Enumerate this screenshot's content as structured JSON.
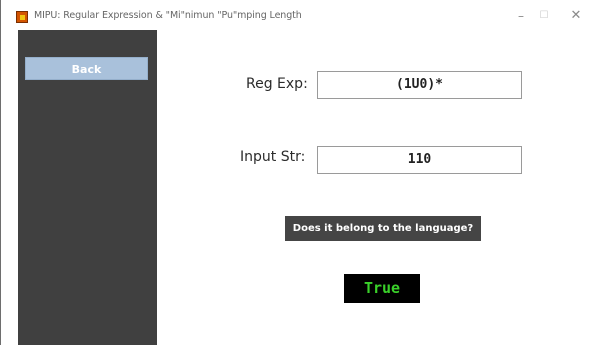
{
  "window": {
    "title": "MIPU: Regular Expression & \"Mi\"nimun \"Pu\"mping Length",
    "controls": {
      "minimize": "–",
      "maximize": "☐",
      "close": "✕"
    }
  },
  "sidebar": {
    "back_label": "Back"
  },
  "form": {
    "regexp_label": "Reg Exp:",
    "regexp_value": "(1U0)*",
    "input_label": "Input Str:",
    "input_value": "110"
  },
  "check_button_label": "Does it belong to the language?",
  "result": {
    "text": "True",
    "color": "#3ad12a"
  },
  "colors": {
    "sidebar_bg": "#404040",
    "back_button_bg": "#a9c1db",
    "check_button_bg": "#454545",
    "result_bg": "#000000"
  }
}
